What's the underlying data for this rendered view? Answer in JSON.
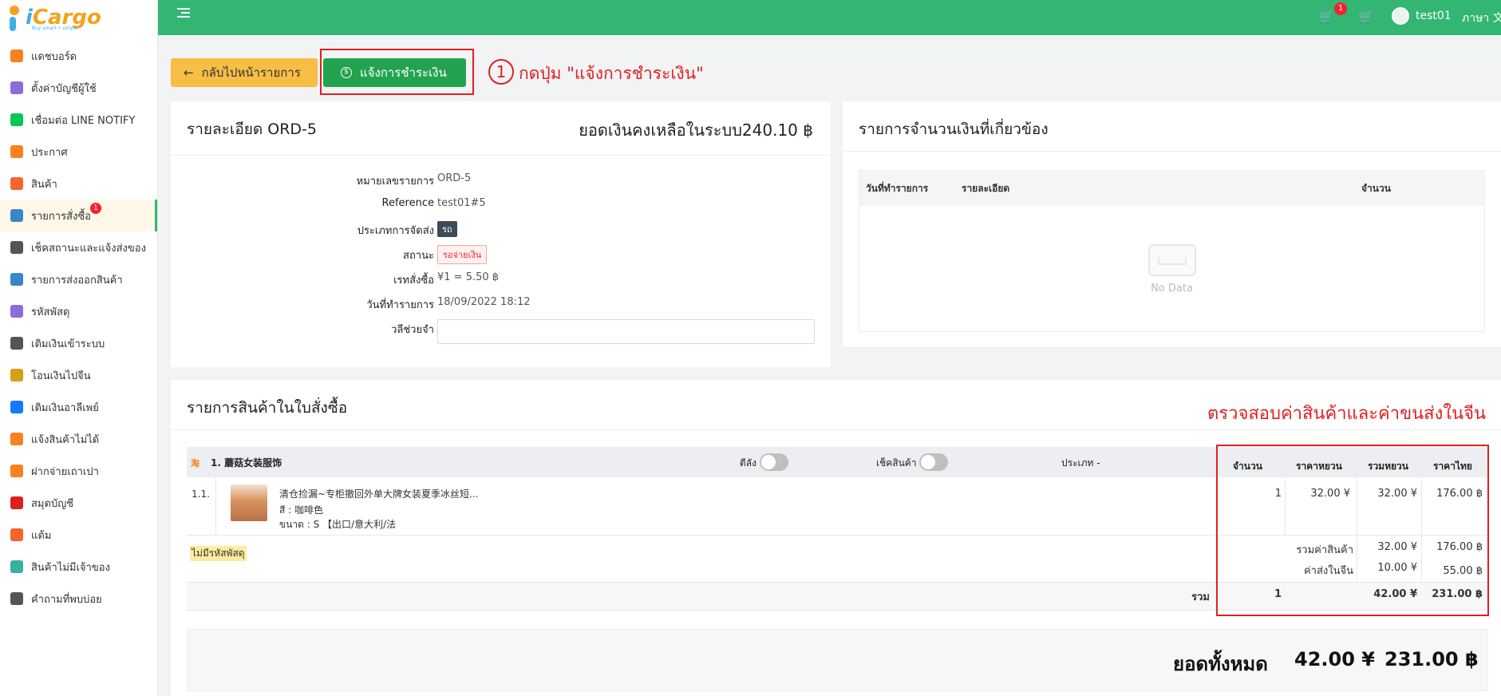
{
  "brand": {
    "logo_text_i": "i",
    "logo_text_rest": "Cargo",
    "tagline": "Buy smart • simple"
  },
  "sidebar": {
    "items": [
      {
        "label": "แดชบอร์ด",
        "icon": "chart-icon",
        "color": "#f5821f"
      },
      {
        "label": "ตั้งค่าบัญชีผู้ใช้",
        "icon": "user-settings-icon",
        "color": "#8c6cd9"
      },
      {
        "label": "เชื่อมต่อ LINE NOTIFY",
        "icon": "line-icon",
        "color": "#06c755"
      },
      {
        "label": "ประกาศ",
        "icon": "megaphone-icon",
        "color": "#f5821f"
      },
      {
        "label": "สินค้า",
        "icon": "product-icon",
        "color": "#f5642d"
      },
      {
        "label": "รายการสั่งซื้อ",
        "icon": "order-icon",
        "color": "#3a87c8",
        "badge": "1"
      },
      {
        "label": "เช็คสถานะและแจ้งส่งของ",
        "icon": "checklist-icon",
        "color": "#555555"
      },
      {
        "label": "รายการส่งออกสินค้า",
        "icon": "truck-icon",
        "color": "#3a87c8"
      },
      {
        "label": "รหัสพัสดุ",
        "icon": "parcel-code-icon",
        "color": "#8c6cd9"
      },
      {
        "label": "เติมเงินเข้าระบบ",
        "icon": "topup-icon",
        "color": "#555555"
      },
      {
        "label": "โอนเงินไปจีน",
        "icon": "yuan-coin-icon",
        "color": "#d4a017"
      },
      {
        "label": "เติมเงินอาลีเพย์",
        "icon": "alipay-icon",
        "color": "#1677ff"
      },
      {
        "label": "แจ้งสินค้าไม่ได้",
        "icon": "report-icon",
        "color": "#f5821f"
      },
      {
        "label": "ฝากจ่ายเถาเปา",
        "icon": "taobao-icon",
        "color": "#f5821f"
      },
      {
        "label": "สมุดบัญชี",
        "icon": "ledger-icon",
        "color": "#e02020"
      },
      {
        "label": "แต้ม",
        "icon": "points-icon",
        "color": "#f5642d"
      },
      {
        "label": "สินค้าไม่มีเจ้าของ",
        "icon": "unclaimed-icon",
        "color": "#3ab0a0"
      },
      {
        "label": "คำถามที่พบบ่อย",
        "icon": "faq-icon",
        "color": "#555555"
      }
    ]
  },
  "header": {
    "cart_badge": "1",
    "username": "test01",
    "language": "ภาษา 文"
  },
  "actions": {
    "back_label": "กลับไปหน้ารายการ",
    "pay_label": "แจ้งการชำระเงิน",
    "step_number": "1",
    "step_text": "กดปุ่ม \"แจ้งการชำระเงิน\""
  },
  "detail": {
    "title": "รายละเอียด ORD-5",
    "balance": "ยอดเงินคงเหลือในระบบ240.10 ฿",
    "fields": [
      {
        "label": "หมายเลขรายการ",
        "value": "ORD-5"
      },
      {
        "label": "Reference",
        "value": "test01#5"
      },
      {
        "label": "ประเภทการจัดส่ง",
        "value": "รถ"
      },
      {
        "label": "สถานะ",
        "value": "รอจ่ายเงิน"
      },
      {
        "label": "เรทสั่งซื้อ",
        "value": "¥1 = 5.50 ฿"
      },
      {
        "label": "วันที่ทำรายการ",
        "value": "18/09/2022 18:12"
      },
      {
        "label": "วลีช่วยจำ",
        "value": ""
      }
    ]
  },
  "transactions": {
    "title": "รายการจำนวนเงินที่เกี่ยวข้อง",
    "columns": [
      "วันที่ทำรายการ",
      "รายละเอียด",
      "จำนวน"
    ],
    "empty_text": "No Data"
  },
  "items": {
    "title": "รายการสินค้าในใบสั่งซื้อ",
    "check_note": "ตรวจสอบค่าสินค้าและค่าขนส่งในจีน",
    "shop_name": "1. 蘑菇女装服饰",
    "toggle_pack_label": "ตีลัง",
    "toggle_check_label": "เช็คสินค้า",
    "type_label": "ประเภท -",
    "columns": [
      "จำนวน",
      "ราคาหยวน",
      "รวมหยวน",
      "ราคาไทย"
    ],
    "rows": [
      {
        "index": "1.1.",
        "name": "清仓捡漏~专柜撤回外单大牌女装夏季冰丝短...",
        "color": "สี : 咖啡色",
        "size": "ขนาด : S 【出口/意大利/法",
        "qty": "1",
        "price_yuan": "32.00 ¥",
        "total_yuan": "32.00 ¥",
        "price_thb": "176.00 ฿"
      }
    ],
    "no_tracking": "ไม่มีรหัสพัสดุ",
    "subtotal_label": "รวมค่าสินค้า",
    "subtotal_yuan": "32.00 ¥",
    "subtotal_thb": "176.00 ฿",
    "shipping_label": "ค่าส่งในจีน",
    "shipping_yuan": "10.00 ¥",
    "shipping_thb": "55.00 ฿",
    "sum_label": "รวม",
    "sum_qty": "1",
    "sum_yuan": "42.00 ¥",
    "sum_thb": "231.00 ฿",
    "grand_label": "ยอดทั้งหมด",
    "grand_yuan": "42.00 ¥",
    "grand_thb": "231.00 ฿"
  },
  "colors": {
    "primary_green": "#33b673",
    "pay_button": "#23a34f",
    "back_button": "#f7bd45",
    "annotation_red": "#e02020"
  }
}
